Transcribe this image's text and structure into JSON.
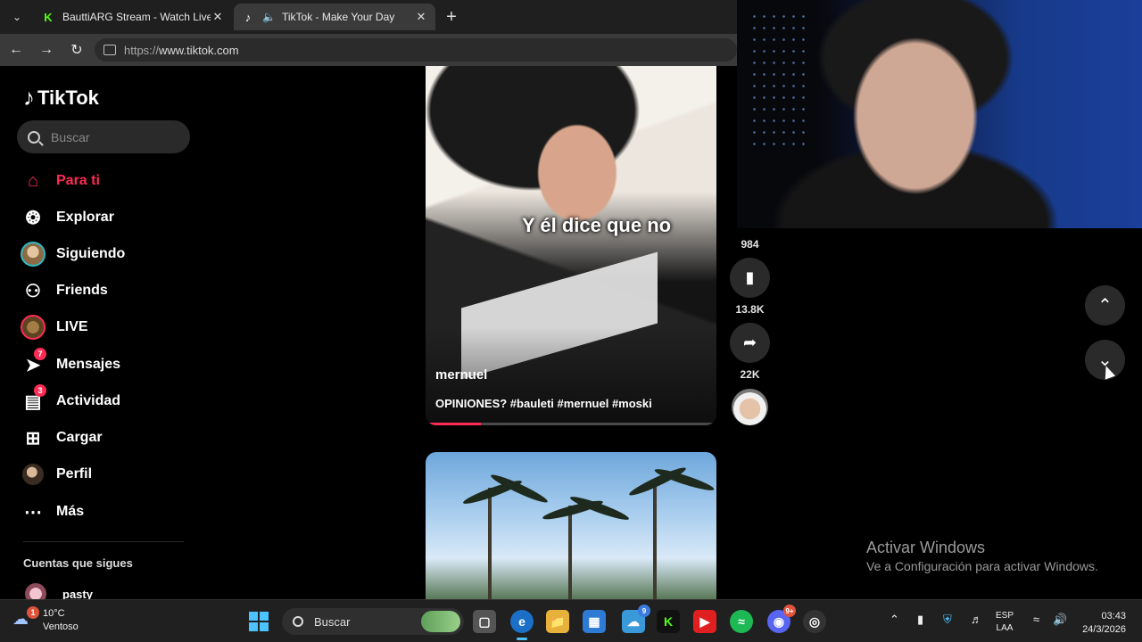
{
  "browser": {
    "tabs": [
      {
        "title": "BauttiARG Stream - Watch Live on",
        "icon": "kick-icon",
        "active": false
      },
      {
        "title": "TikTok - Make Your Day",
        "icon": "tiktok-icon",
        "active": true
      }
    ],
    "url_prefix": "https://",
    "url_host": "www.tiktok.com"
  },
  "sidebar": {
    "logo_text": "TikTok",
    "search_placeholder": "Buscar",
    "items": [
      {
        "label": "Para ti",
        "icon": "home-icon",
        "active": true
      },
      {
        "label": "Explorar",
        "icon": "compass-icon"
      },
      {
        "label": "Siguiendo",
        "icon": "following-avatar-icon"
      },
      {
        "label": "Friends",
        "icon": "friends-icon"
      },
      {
        "label": "LIVE",
        "icon": "live-avatar-icon"
      },
      {
        "label": "Mensajes",
        "icon": "messages-icon",
        "badge": "7"
      },
      {
        "label": "Actividad",
        "icon": "activity-icon",
        "badge": "3"
      },
      {
        "label": "Cargar",
        "icon": "upload-icon"
      },
      {
        "label": "Perfil",
        "icon": "profile-avatar-icon"
      },
      {
        "label": "Más",
        "icon": "more-icon"
      }
    ],
    "following_title": "Cuentas que sigues",
    "following": [
      {
        "name": "pasty"
      }
    ]
  },
  "video": {
    "caption_overlay": "Y él dice que no",
    "author": "mernuel",
    "description": "OPINIONES? #bauleti #mernuel #moski",
    "progress": 0.19
  },
  "actions": {
    "comments": "984",
    "saves": "13.8K",
    "shares": "22K"
  },
  "watermark": {
    "title": "Activar Windows",
    "subtitle": "Ve a Configuración para activar Windows."
  },
  "taskbar": {
    "weather_temp": "10°C",
    "weather_desc": "Ventoso",
    "weather_badge": "1",
    "search_label": "Buscar",
    "store_badge": "9",
    "discord_badge": "9+",
    "lang_top": "ESP",
    "lang_bottom": "LAA",
    "time": "03:43",
    "date": "24/3/2026"
  },
  "colors": {
    "accent": "#fe2c55",
    "kick_green": "#53fc18",
    "windows_blue": "#4cc2ff"
  }
}
